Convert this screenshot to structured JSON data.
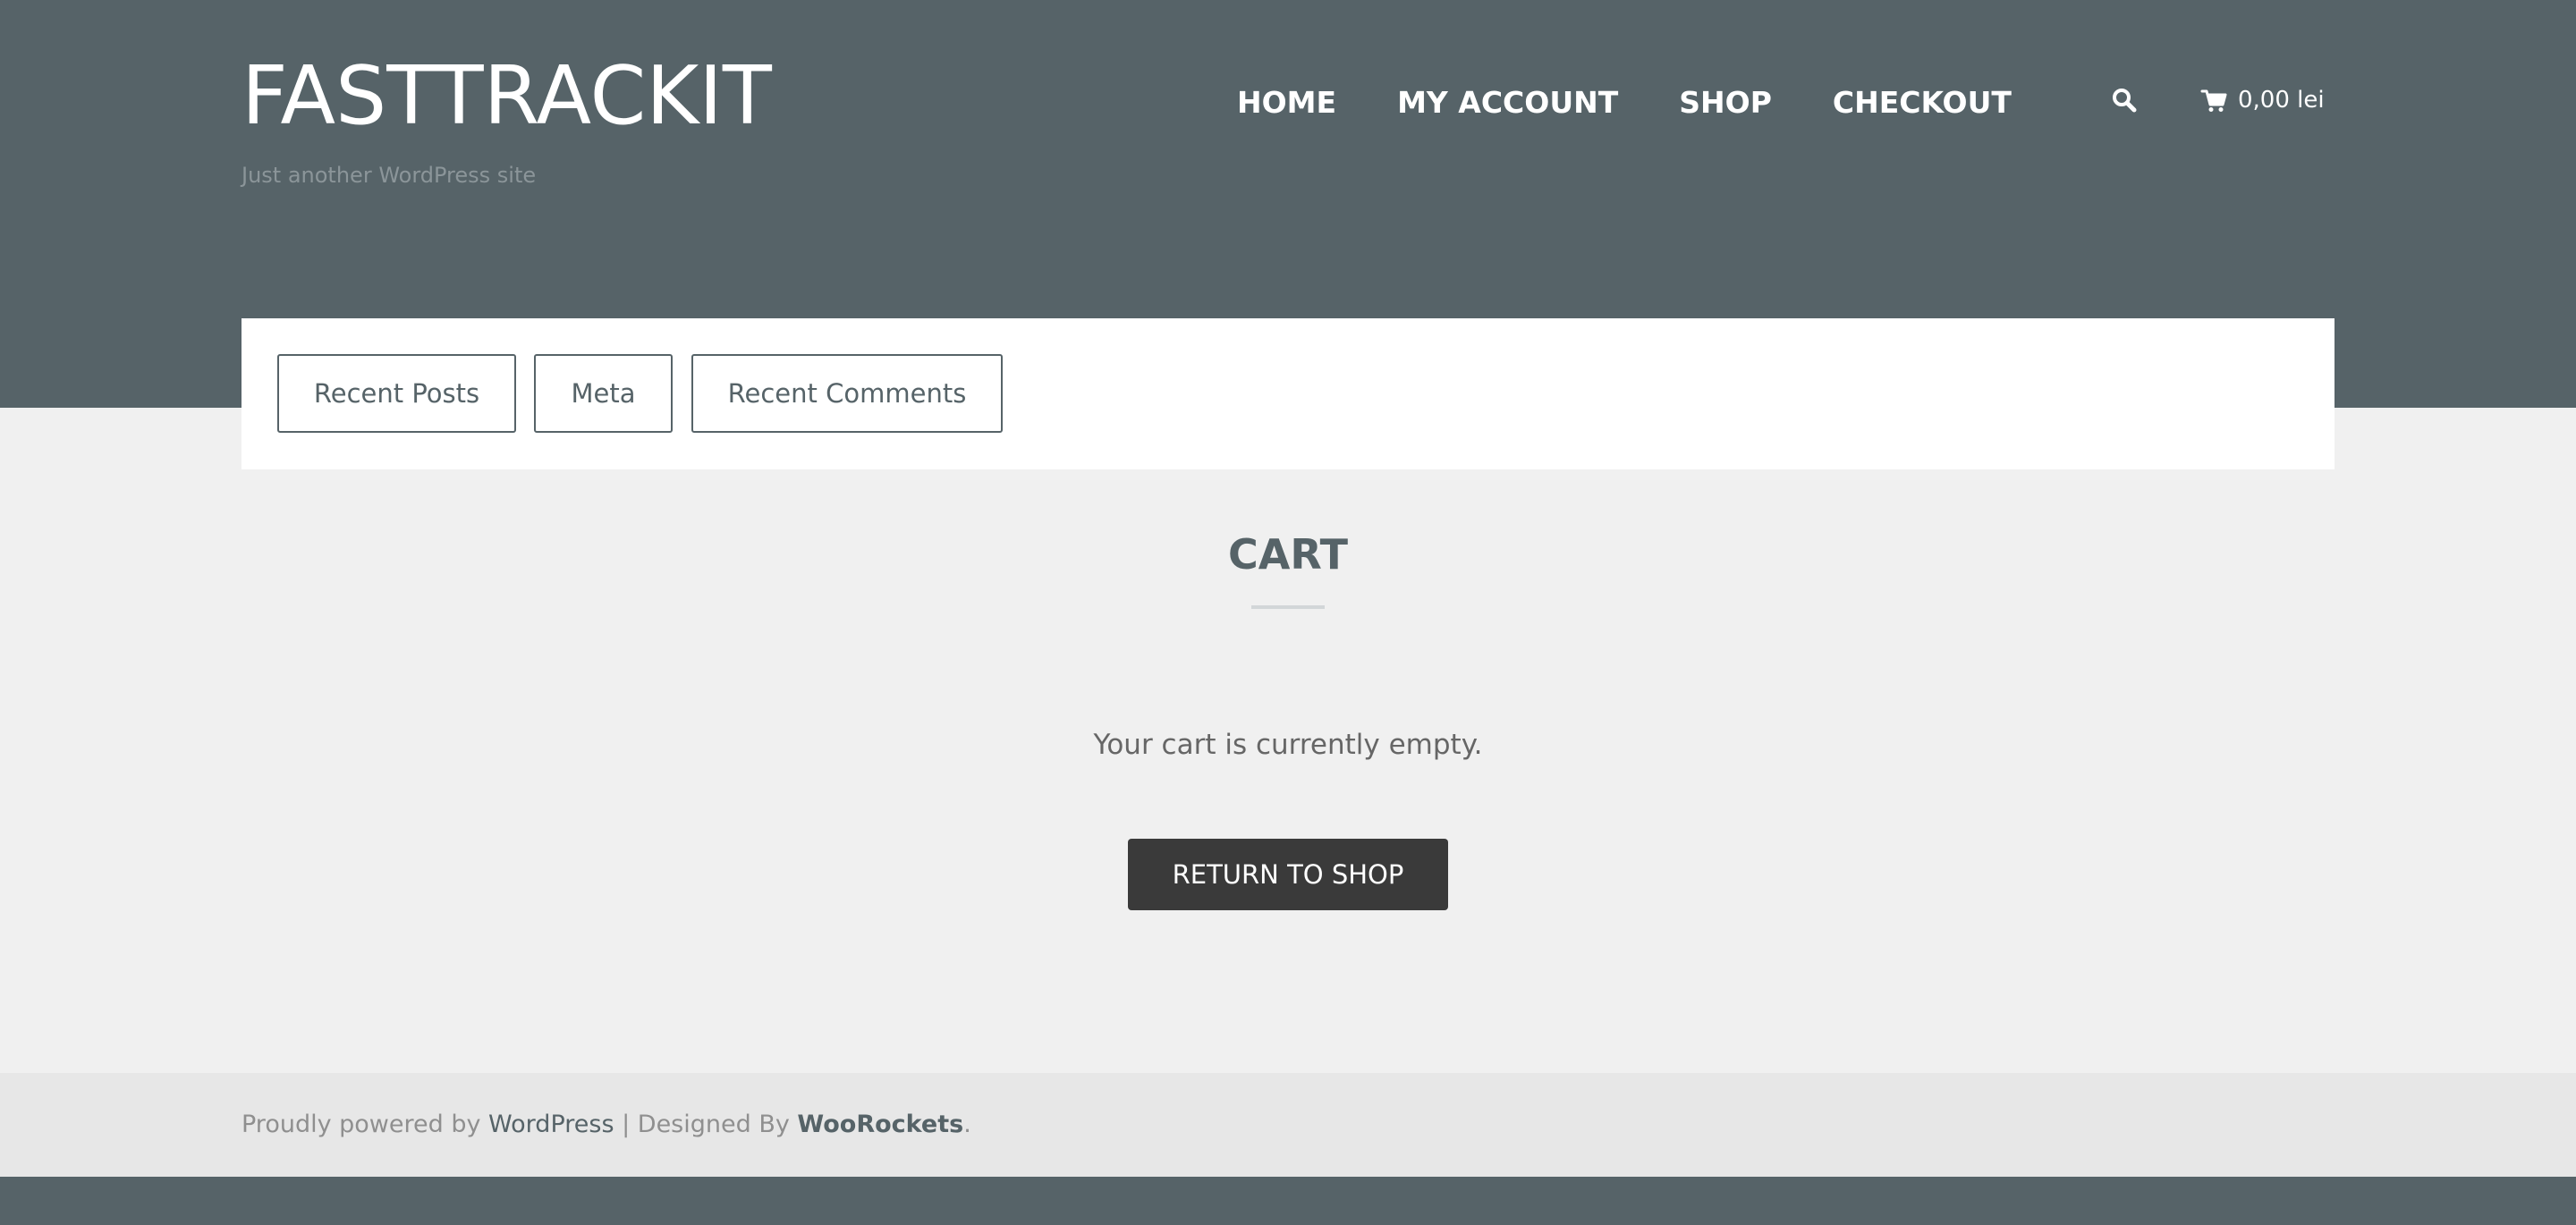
{
  "header": {
    "site_title": "FASTTRACKIT",
    "tagline": "Just another WordPress site",
    "nav": [
      {
        "label": "HOME"
      },
      {
        "label": "MY ACCOUNT"
      },
      {
        "label": "SHOP"
      },
      {
        "label": "CHECKOUT"
      }
    ],
    "search_icon": "search-icon",
    "cart_icon": "cart-icon",
    "cart_total": "0,00 lei"
  },
  "widgets": {
    "tabs": [
      {
        "label": "Recent Posts"
      },
      {
        "label": "Meta"
      },
      {
        "label": "Recent Comments"
      }
    ]
  },
  "main": {
    "title": "CART",
    "empty_message": "Your cart is currently empty.",
    "return_button": "RETURN TO SHOP"
  },
  "footer": {
    "prefix": "Proudly powered by ",
    "wordpress_link": "WordPress",
    "separator": " | Designed By ",
    "woorockets_link": "WooRockets",
    "suffix": "."
  },
  "colors": {
    "header_bg": "#566368",
    "page_bg": "#f0f0f0",
    "footer_bg": "#e7e7e7",
    "button_bg": "#3a3a3a",
    "accent_text": "#566368"
  }
}
